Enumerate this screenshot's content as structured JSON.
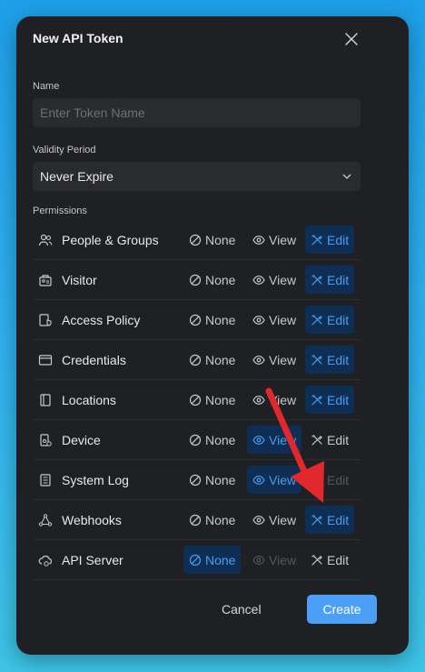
{
  "modal": {
    "title": "New API Token",
    "name_label": "Name",
    "name_placeholder": "Enter Token Name",
    "validity_label": "Validity Period",
    "validity_value": "Never Expire",
    "permissions_label": "Permissions",
    "cancel_label": "Cancel",
    "create_label": "Create"
  },
  "options": {
    "none": "None",
    "view": "View",
    "edit": "Edit"
  },
  "permissions": [
    {
      "name": "People & Groups",
      "icon": "people-icon",
      "selected": "edit",
      "disabled": []
    },
    {
      "name": "Visitor",
      "icon": "visitor-icon",
      "selected": "edit",
      "disabled": []
    },
    {
      "name": "Access Policy",
      "icon": "access-policy-icon",
      "selected": "edit",
      "disabled": []
    },
    {
      "name": "Credentials",
      "icon": "credentials-icon",
      "selected": "edit",
      "disabled": []
    },
    {
      "name": "Locations",
      "icon": "locations-icon",
      "selected": "edit",
      "disabled": []
    },
    {
      "name": "Device",
      "icon": "device-icon",
      "selected": "view",
      "disabled": []
    },
    {
      "name": "System Log",
      "icon": "system-log-icon",
      "selected": "view",
      "disabled": [
        "edit"
      ]
    },
    {
      "name": "Webhooks",
      "icon": "webhooks-icon",
      "selected": "edit",
      "disabled": []
    },
    {
      "name": "API Server",
      "icon": "api-server-icon",
      "selected": "none",
      "disabled": [
        "view"
      ]
    }
  ],
  "colors": {
    "accent": "#4b9ff5",
    "selected_bg": "#0f2e54",
    "selected_text": "#4a9ef0",
    "annotation_arrow": "#e0282d"
  }
}
